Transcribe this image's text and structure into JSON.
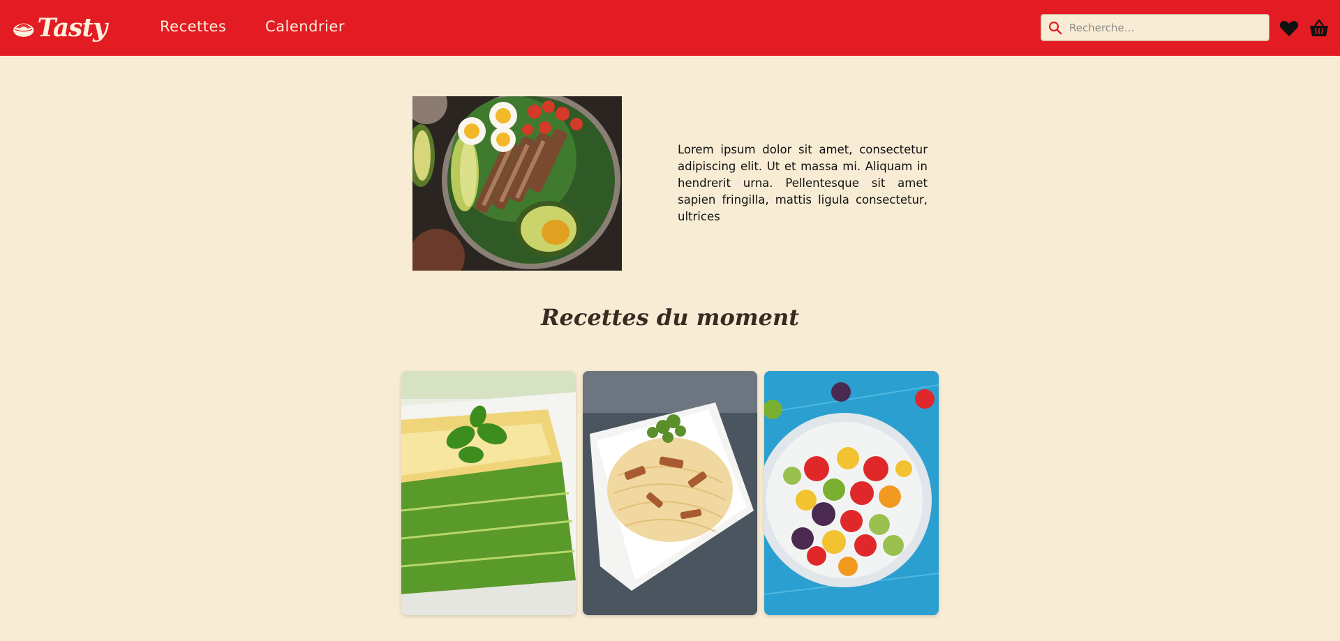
{
  "header": {
    "logo_text": "Tasty",
    "nav": [
      {
        "label": "Recettes"
      },
      {
        "label": "Calendrier"
      }
    ],
    "search": {
      "placeholder": "Recherche..."
    },
    "icons": [
      "search-icon",
      "heart-icon",
      "basket-icon"
    ],
    "colors": {
      "header_bg": "#e31b23",
      "page_bg": "#f8ecd4",
      "title": "#3b2a22"
    }
  },
  "hero": {
    "image": "salad-bowl-image",
    "text": "Lorem ipsum dolor sit amet, consectetur adipiscing elit. Ut et massa mi. Aliquam in hendrerit urna. Pellentesque sit amet sapien fringilla, mattis ligula consectetur, ultrices"
  },
  "featured": {
    "title": "Recettes du moment",
    "cards": [
      {
        "image": "lasagna-image"
      },
      {
        "image": "carbonara-image"
      },
      {
        "image": "fruit-salad-image"
      }
    ]
  }
}
